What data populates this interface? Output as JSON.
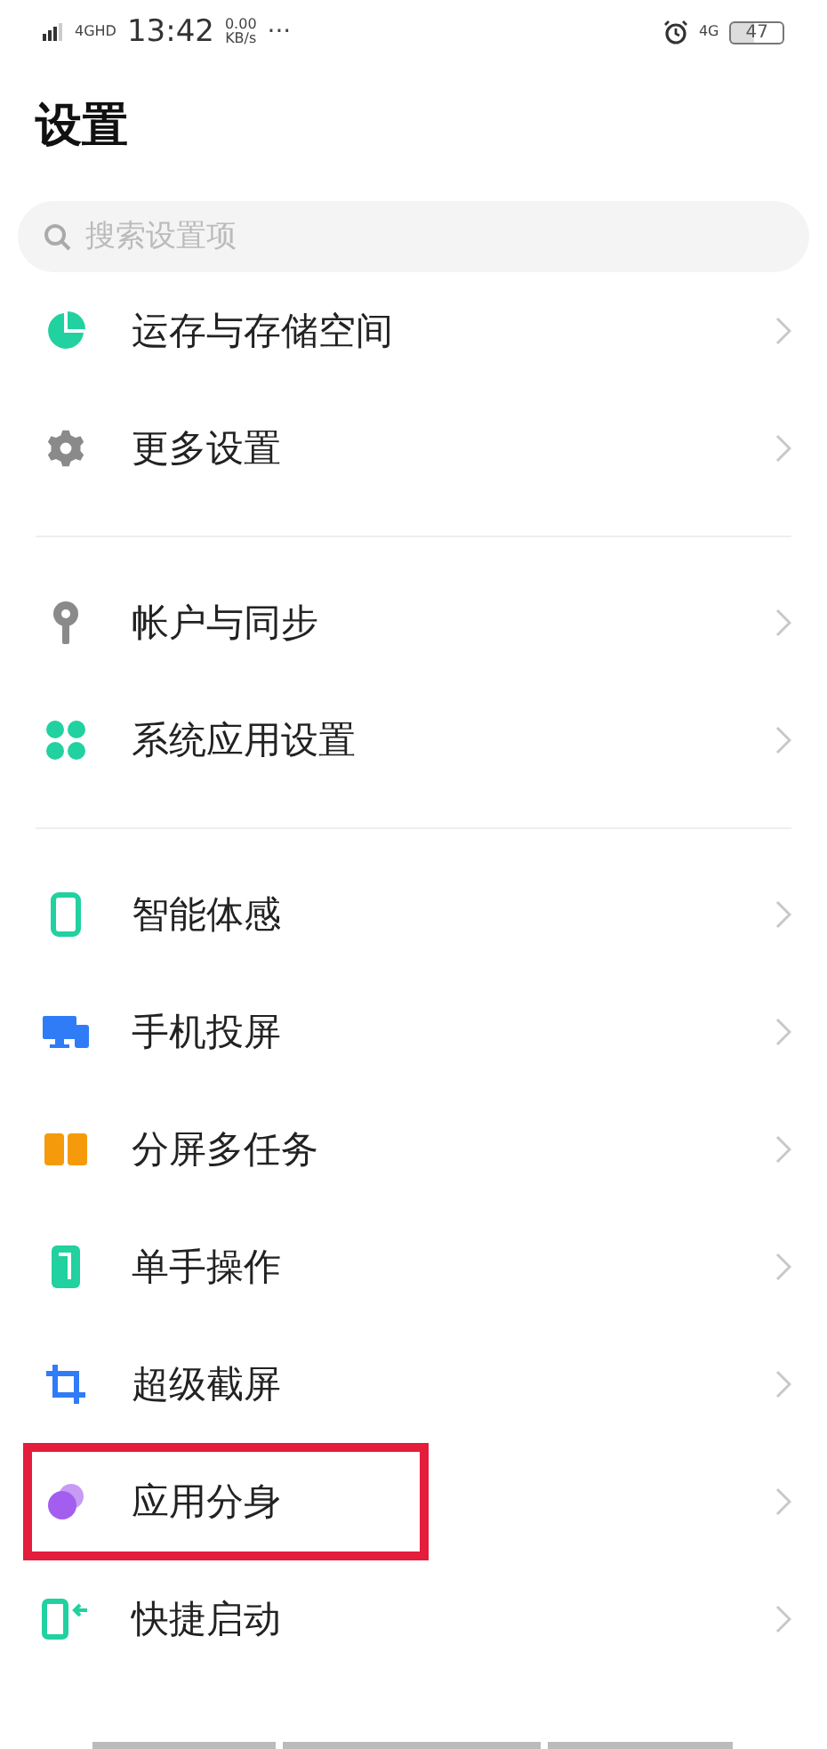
{
  "status_bar": {
    "network": "4GHD",
    "time": "13:42",
    "speed_value": "0.00",
    "speed_unit": "KB/s",
    "more": "···",
    "mobile": "4G",
    "battery": "47"
  },
  "title": "设置",
  "search": {
    "placeholder": "搜索设置项"
  },
  "groups": [
    {
      "items": [
        {
          "kind": "storage",
          "label": "运存与存储空间",
          "highlighted": false
        },
        {
          "kind": "gear",
          "label": "更多设置",
          "highlighted": false
        }
      ]
    },
    {
      "items": [
        {
          "kind": "key",
          "label": "帐户与同步",
          "highlighted": false
        },
        {
          "kind": "apps",
          "label": "系统应用设置",
          "highlighted": false
        }
      ]
    },
    {
      "items": [
        {
          "kind": "motion",
          "label": "智能体感",
          "highlighted": false
        },
        {
          "kind": "cast",
          "label": "手机投屏",
          "highlighted": false
        },
        {
          "kind": "split",
          "label": "分屏多任务",
          "highlighted": false
        },
        {
          "kind": "onehand",
          "label": "单手操作",
          "highlighted": false
        },
        {
          "kind": "crop",
          "label": "超级截屏",
          "highlighted": false
        },
        {
          "kind": "clone",
          "label": "应用分身",
          "highlighted": true
        },
        {
          "kind": "launch",
          "label": "快捷启动",
          "highlighted": false
        }
      ]
    }
  ]
}
